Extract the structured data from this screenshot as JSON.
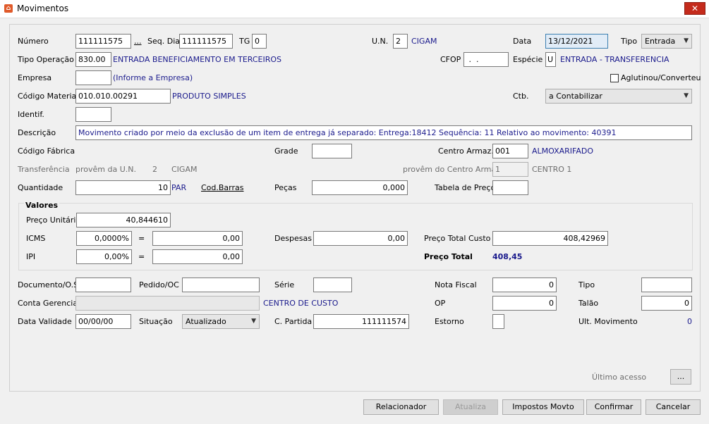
{
  "window": {
    "title": "Movimentos",
    "close_glyph": "✕",
    "app_icon": "movements-app-icon"
  },
  "row1": {
    "numero_label": "Número",
    "numero": "111111575",
    "numero_btn": "...",
    "seqdia_label": "Seq. Dia",
    "seqdia": "111111575",
    "tg_label": "TG",
    "tg": "0",
    "un_label": "U.N.",
    "un": "2",
    "un_name": "CIGAM",
    "data_label": "Data",
    "data": "13/12/2021",
    "tipo_label": "Tipo",
    "tipo": "Entrada"
  },
  "row2": {
    "tipo_op_label": "Tipo Operação",
    "tipo_op": "830.00",
    "tipo_op_desc": "ENTRADA BENEFICIAMENTO EM TERCEIROS",
    "cfop_label": "CFOP",
    "cfop": " .  .",
    "especie_label": "Espécie",
    "especie": "U",
    "especie_desc": "ENTRADA - TRANSFERENCIA"
  },
  "row3": {
    "empresa_label": "Empresa",
    "empresa": "",
    "empresa_hint": "(Informe a Empresa)",
    "aglutinou_label": "Aglutinou/Converteu"
  },
  "row4": {
    "codmat_label": "Código Material",
    "codmat": "010.010.00291",
    "codmat_desc": "PRODUTO SIMPLES",
    "ctb_label": "Ctb.",
    "ctb": "a Contabilizar"
  },
  "row5": {
    "identif_label": "Identif.",
    "identif": ""
  },
  "row6": {
    "descricao_label": "Descrição",
    "descricao": "Movimento criado por meio da exclusão de um item de entrega já separado: Entrega:18412 Sequência: 11 Relativo ao movimento: 40391"
  },
  "row7": {
    "codfab_label": "Código Fábrica",
    "grade_label": "Grade",
    "grade": "",
    "centro_label": "Centro Armaz.",
    "centro": "001",
    "centro_desc": "ALMOXARIFADO"
  },
  "row8": {
    "transf_label": "Transferência",
    "provem_un_label": "provêm da U.N.",
    "provem_un": "2",
    "provem_un_name": "CIGAM",
    "provem_centro_label": "provêm do Centro Armaz",
    "provem_centro": "1",
    "provem_centro_desc": "CENTRO 1"
  },
  "row9": {
    "quantidade_label": "Quantidade",
    "quantidade": "10",
    "unidade": "PAR",
    "codbarras_link": "Cod.Barras",
    "pecas_label": "Peças",
    "pecas": "0,000",
    "tabela_label": "Tabela de Preço",
    "tabela": ""
  },
  "valores": {
    "title": "Valores",
    "preco_unit_label": "Preço Unitário",
    "preco_unit": "40,844610",
    "icms_label": "ICMS",
    "icms_pct": "0,0000%",
    "eq": "=",
    "icms_val": "0,00",
    "despesas_label": "Despesas",
    "despesas": "0,00",
    "preco_total_custo_label": "Preço Total Custo",
    "preco_total_custo": "408,42969",
    "ipi_label": "IPI",
    "ipi_pct": "0,00%",
    "ipi_val": "0,00",
    "preco_total_label": "Preço Total",
    "preco_total": "408,45"
  },
  "rowA": {
    "documento_label": "Documento/O.S",
    "documento": "",
    "pedido_label": "Pedido/OC",
    "pedido": "",
    "serie_label": "Série",
    "serie": "",
    "nf_label": "Nota Fiscal",
    "nf": "0",
    "tipo2_label": "Tipo",
    "tipo2": ""
  },
  "rowB": {
    "conta_label": "Conta Gerencial",
    "conta": "",
    "centro_custo_label": "CENTRO DE CUSTO",
    "op_label": "OP",
    "op": "0",
    "talao_label": "Talão",
    "talao": "0"
  },
  "rowC": {
    "validade_label": "Data Validade",
    "validade": "00/00/00",
    "situacao_label": "Situação",
    "situacao": "Atualizado",
    "cpartida_label": "C. Partida",
    "cpartida": "111111574",
    "estorno_label": "Estorno",
    "estorno": "",
    "ult_mov_label": "Ult. Movimento",
    "ult_mov": "0"
  },
  "footer": {
    "ultimo_acesso_label": "Último acesso",
    "ultimo_acesso_btn": "..."
  },
  "buttons": {
    "relacionador": "Relacionador",
    "atualiza": "Atualiza",
    "impostos": "Impostos Movto",
    "confirmar": "Confirmar",
    "cancelar": "Cancelar"
  },
  "colors": {
    "accent_blue": "#1a1a8c",
    "close_red": "#c42b1c"
  }
}
